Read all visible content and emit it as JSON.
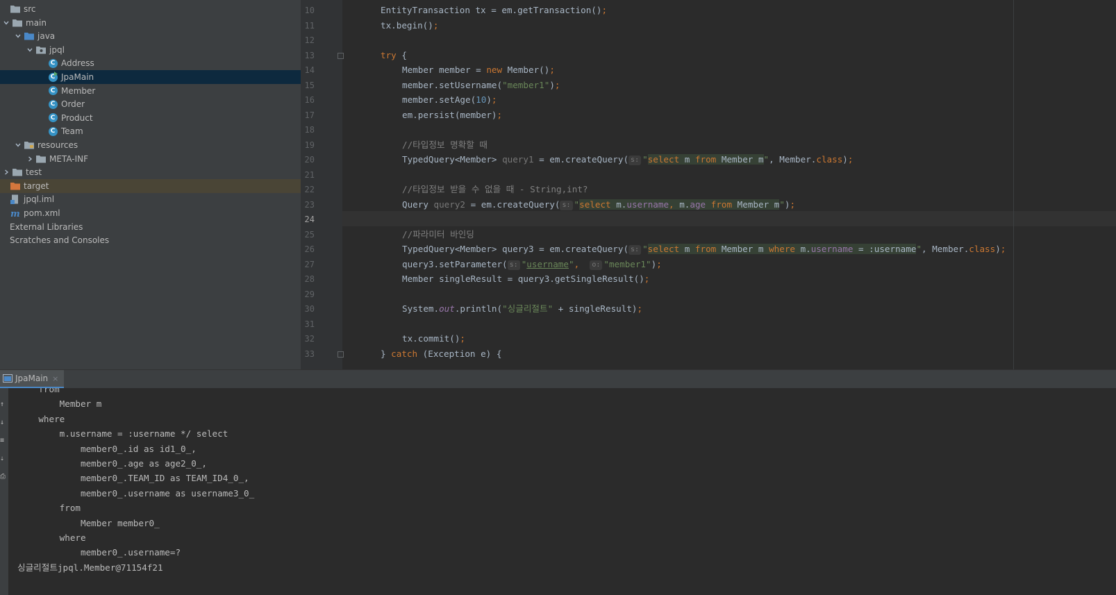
{
  "project_tree": [
    {
      "label": "src",
      "indent": 0,
      "chevron": "",
      "icon": "folder"
    },
    {
      "label": "main",
      "indent": 1,
      "chevron": "down",
      "icon": "folder"
    },
    {
      "label": "java",
      "indent": 2,
      "chevron": "down",
      "icon": "source-folder"
    },
    {
      "label": "jpql",
      "indent": 3,
      "chevron": "down",
      "icon": "package"
    },
    {
      "label": "Address",
      "indent": 4,
      "chevron": "",
      "icon": "class"
    },
    {
      "label": "JpaMain",
      "indent": 4,
      "chevron": "",
      "icon": "class-main",
      "selected": true
    },
    {
      "label": "Member",
      "indent": 4,
      "chevron": "",
      "icon": "class"
    },
    {
      "label": "Order",
      "indent": 4,
      "chevron": "",
      "icon": "class"
    },
    {
      "label": "Product",
      "indent": 4,
      "chevron": "",
      "icon": "class"
    },
    {
      "label": "Team",
      "indent": 4,
      "chevron": "",
      "icon": "class"
    },
    {
      "label": "resources",
      "indent": 2,
      "chevron": "down",
      "icon": "resources-folder"
    },
    {
      "label": "META-INF",
      "indent": 3,
      "chevron": "right",
      "icon": "folder"
    },
    {
      "label": "test",
      "indent": 1,
      "chevron": "right",
      "icon": "folder"
    },
    {
      "label": "target",
      "indent": 0,
      "chevron": "",
      "icon": "excluded-folder",
      "excluded": true
    },
    {
      "label": "jpql.iml",
      "indent": 0,
      "chevron": "",
      "icon": "iml-file"
    },
    {
      "label": "pom.xml",
      "indent": 0,
      "chevron": "",
      "icon": "maven-file"
    },
    {
      "label": "External Libraries",
      "indent": 0,
      "chevron": "",
      "icon": "none"
    },
    {
      "label": "Scratches and Consoles",
      "indent": 0,
      "chevron": "",
      "icon": "none"
    }
  ],
  "editor": {
    "current_line": 24,
    "fold_lines": [
      13,
      33
    ],
    "lines": [
      {
        "n": 10,
        "indent": 2,
        "tokens": [
          [
            "EntityTransaction tx = em.getTransaction()",
            ""
          ],
          [
            ";",
            "kw"
          ]
        ]
      },
      {
        "n": 11,
        "indent": 2,
        "tokens": [
          [
            "tx.begin()",
            ""
          ],
          [
            ";",
            "kw"
          ]
        ]
      },
      {
        "n": 12,
        "indent": 0,
        "tokens": []
      },
      {
        "n": 13,
        "indent": 2,
        "tokens": [
          [
            "try",
            "kw"
          ],
          [
            " {",
            ""
          ]
        ]
      },
      {
        "n": 14,
        "indent": 3,
        "tokens": [
          [
            "Member member = ",
            ""
          ],
          [
            "new",
            "kw"
          ],
          [
            " Member()",
            ""
          ],
          [
            ";",
            "kw"
          ]
        ]
      },
      {
        "n": 15,
        "indent": 3,
        "tokens": [
          [
            "member.setUsername(",
            ""
          ],
          [
            "\"member1\"",
            "str"
          ],
          [
            ")",
            ""
          ],
          [
            ";",
            "kw"
          ]
        ]
      },
      {
        "n": 16,
        "indent": 3,
        "tokens": [
          [
            "member.setAge(",
            ""
          ],
          [
            "10",
            "num"
          ],
          [
            ")",
            ""
          ],
          [
            ";",
            "kw"
          ]
        ]
      },
      {
        "n": 17,
        "indent": 3,
        "tokens": [
          [
            "em.persist(member)",
            ""
          ],
          [
            ";",
            "kw"
          ]
        ]
      },
      {
        "n": 18,
        "indent": 0,
        "tokens": []
      },
      {
        "n": 19,
        "indent": 3,
        "tokens": [
          [
            "//타입정보 명확할 때",
            "cm"
          ]
        ]
      },
      {
        "n": 20,
        "indent": 3,
        "tokens": [
          [
            "TypedQuery<Member> ",
            ""
          ],
          [
            "query1",
            "gry"
          ],
          [
            " = em.createQuery(",
            ""
          ],
          [
            "s:",
            "hint"
          ],
          [
            "\"",
            "str"
          ],
          [
            "select",
            "kw inj"
          ],
          [
            " m ",
            "inj"
          ],
          [
            "from",
            "kw inj"
          ],
          [
            " Member m",
            "inj"
          ],
          [
            "\"",
            "str"
          ],
          [
            ", Member.",
            ""
          ],
          [
            "class",
            "kw"
          ],
          [
            ")",
            ""
          ],
          [
            ";",
            "kw"
          ]
        ]
      },
      {
        "n": 21,
        "indent": 0,
        "tokens": []
      },
      {
        "n": 22,
        "indent": 3,
        "tokens": [
          [
            "//타입정보 받을 수 없을 때 - String,int?",
            "cm"
          ]
        ]
      },
      {
        "n": 23,
        "indent": 3,
        "tokens": [
          [
            "Query ",
            ""
          ],
          [
            "query2",
            "gry"
          ],
          [
            " = em.createQuery(",
            ""
          ],
          [
            "s:",
            "hint"
          ],
          [
            "\"",
            "str"
          ],
          [
            "select",
            "kw inj"
          ],
          [
            " m.",
            "inj"
          ],
          [
            "username",
            "fld inj"
          ],
          [
            ", ",
            "kw inj"
          ],
          [
            "m.",
            "inj"
          ],
          [
            "age",
            "fld inj"
          ],
          [
            " ",
            "inj"
          ],
          [
            "from",
            "kw inj"
          ],
          [
            " Member m",
            "inj"
          ],
          [
            "\"",
            "str"
          ],
          [
            ")",
            ""
          ],
          [
            ";",
            "kw"
          ]
        ]
      },
      {
        "n": 24,
        "indent": 0,
        "tokens": []
      },
      {
        "n": 25,
        "indent": 3,
        "tokens": [
          [
            "//파라미터 바인딩",
            "cm"
          ]
        ]
      },
      {
        "n": 26,
        "indent": 3,
        "tokens": [
          [
            "TypedQuery<Member> query3 = em.createQuery(",
            ""
          ],
          [
            "s:",
            "hint"
          ],
          [
            "\"",
            "str"
          ],
          [
            "select",
            "kw inj"
          ],
          [
            " m ",
            "inj"
          ],
          [
            "from",
            "kw inj"
          ],
          [
            " Member m ",
            "inj"
          ],
          [
            "where",
            "kw inj"
          ],
          [
            " m.",
            "inj"
          ],
          [
            "username",
            "fld inj"
          ],
          [
            " = :username",
            "inj"
          ],
          [
            "\"",
            "str"
          ],
          [
            ", Member.",
            ""
          ],
          [
            "class",
            "kw"
          ],
          [
            ")",
            ""
          ],
          [
            ";",
            "kw"
          ]
        ]
      },
      {
        "n": 27,
        "indent": 3,
        "tokens": [
          [
            "query3.setParameter(",
            ""
          ],
          [
            "s:",
            "hint"
          ],
          [
            "\"",
            "str"
          ],
          [
            "username",
            "str ul"
          ],
          [
            "\"",
            "str"
          ],
          [
            ",  ",
            "kw"
          ],
          [
            "o:",
            "hint"
          ],
          [
            "\"member1\"",
            "str"
          ],
          [
            ")",
            ""
          ],
          [
            ";",
            "kw"
          ]
        ]
      },
      {
        "n": 28,
        "indent": 3,
        "tokens": [
          [
            "Member singleResult = query3.getSingleResult()",
            ""
          ],
          [
            ";",
            "kw"
          ]
        ]
      },
      {
        "n": 29,
        "indent": 0,
        "tokens": []
      },
      {
        "n": 30,
        "indent": 3,
        "tokens": [
          [
            "System.",
            ""
          ],
          [
            "out",
            "fld ital"
          ],
          [
            ".println(",
            ""
          ],
          [
            "\"싱글리절트\"",
            "str"
          ],
          [
            " + singleResult)",
            ""
          ],
          [
            ";",
            "kw"
          ]
        ]
      },
      {
        "n": 31,
        "indent": 0,
        "tokens": []
      },
      {
        "n": 32,
        "indent": 3,
        "tokens": [
          [
            "tx.commit()",
            ""
          ],
          [
            ";",
            "kw"
          ]
        ]
      },
      {
        "n": 33,
        "indent": 2,
        "tokens": [
          [
            "} ",
            ""
          ],
          [
            "catch",
            "kw"
          ],
          [
            " (Exception e) {",
            ""
          ]
        ]
      }
    ]
  },
  "run_panel": {
    "tab_label": "JpaMain",
    "close_glyph": "×",
    "output_lines": [
      "    from",
      "        Member m",
      "    where",
      "        m.username = :username */ select",
      "            member0_.id as id1_0_,",
      "            member0_.age as age2_0_,",
      "            member0_.TEAM_ID as TEAM_ID4_0_,",
      "            member0_.username as username3_0_",
      "        from",
      "            Member member0_",
      "        where",
      "            member0_.username=?",
      "싱글리절트jpql.Member@71154f21"
    ]
  },
  "colors": {
    "keyword": "#cc7832",
    "string": "#6a8759",
    "number": "#6897bb",
    "comment": "#808080",
    "field": "#9876aa",
    "selection": "#0d293e",
    "excluded": "#4a4536"
  }
}
